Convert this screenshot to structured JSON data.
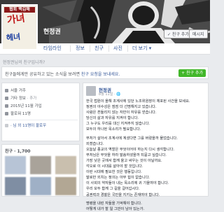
{
  "profile": {
    "name": "현정권",
    "poster_title": "협회 백김해",
    "poster_big_1": "가녀",
    "poster_big_2": "헤녀"
  },
  "cover_buttons": {
    "friend": "✓ 친구 추가",
    "message": "메시지"
  },
  "nav": {
    "tabs": [
      "타임라인",
      "정보",
      "친구",
      "사진",
      "더 보기 ▾"
    ]
  },
  "notice_bar": "현정권님의 친구입니까?",
  "request": {
    "prefix": "친구들에게만 공유하고 있는 소식을 보려면 ",
    "link": "친구 요청을 보내세요.",
    "button": "+ 친구 추가"
  },
  "intro": {
    "rows": [
      {
        "icon": "globe-icon",
        "text": "서울 거주"
      },
      {
        "icon": "clock-icon",
        "text": "기타 정보",
        "muted": "· 추가"
      },
      {
        "icon": "calendar-icon",
        "text": "2015년 11월 가입"
      },
      {
        "icon": "people-icon",
        "text": "팔로워 11명"
      }
    ],
    "friends_line_prefix": "",
    "friends_line_link": "· 님 외 11명이 팔로우"
  },
  "friends": {
    "title": "친구 · 1,700",
    "thumb_colors": [
      "#b7c4d6",
      "#a9a39a",
      "#c9bfae",
      "#7f8ea3",
      "#9fb0c6",
      "#b2a794"
    ]
  },
  "post": {
    "author": "현정권",
    "meta": "8월 11일 · 🌐",
    "lines": [
      "한국 법원이 올해 조계사에 있던 노조위원장이 체포된 사건을 보세요.",
      "정권의 야수성은 점점 더 선명해지고 있습니다.",
      "사람은 흔들리지 않는 자만이 자유를 얻습니다.",
      "당신의 삶과 자유를 지켜야 합니다.",
      "그 누구도 우리를 대신 지켜주지 않습니다.",
      "모두의 하나된 목소리가 필요합니다.",
      "",
      "부처가 살아서 조계사에 계셨다면 그를 버렸을까 물었습니다.",
      "외쳤습니다.",
      "오늘날 종교의 역할은 무엇이어야 하는지 다시 생각합니다.",
      "부처님은 무엇을 하라 말씀하셨을까 되묻고 싶습니다.",
      "가장 낮은 곳에서 함께 울고 싸우는 것이 아닐까요.",
      "각오로 이 시대를 살아야 할 것입니다.",
      "이런 시대에 필요한 것은 행동입니다.",
      "말로만 외치는 정의는 아무 힘이 없습니다.",
      "이 사회의 약자들이 내는 목소리에 귀 기울여야 합니다.",
      "우리 모두 함께 그 길을 걸어갑시다.",
      "공권력과 경찰은 국민을 지키는 존재여야 합니다.",
      "",
      "명령을 내린 자들을 기억해야 합니다.",
      "어떻게 내가 할 일 그만이 남아 있는가."
    ]
  },
  "colors": {
    "link": "#365899",
    "green": "#42b72a",
    "page_bg": "#e9ebee"
  }
}
